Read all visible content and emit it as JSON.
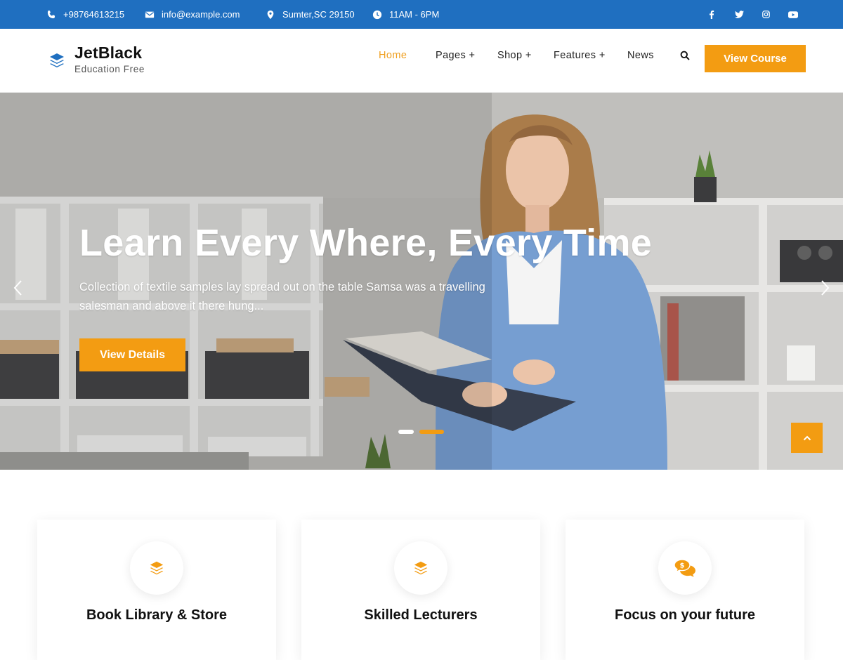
{
  "topbar": {
    "phone": "+98764613215",
    "email": "info@example.com",
    "address": "Sumter,SC 29150",
    "hours": "11AM - 6PM",
    "social": [
      "facebook-icon",
      "twitter-icon",
      "instagram-icon",
      "youtube-icon"
    ],
    "color": "#1f6fc0"
  },
  "header": {
    "logo_title": "JetBlack",
    "logo_subtitle": "Education Free",
    "nav": [
      {
        "label": "Home",
        "active": true
      },
      {
        "label": "Pages +"
      },
      {
        "label": "Shop +"
      },
      {
        "label": "Features +"
      },
      {
        "label": "News"
      }
    ],
    "cta_label": "View Course",
    "accent": "#f39c12"
  },
  "hero": {
    "title": "Learn Every Where, Every Time",
    "text": "Collection of textile samples lay spread out on the table Samsa was a travelling salesman and above it there hung...",
    "button_label": "View Details",
    "slides_total": 2,
    "active_slide": 2
  },
  "features": [
    {
      "title": "Book Library & Store",
      "icon": "layers-icon"
    },
    {
      "title": "Skilled Lecturers",
      "icon": "layers-icon"
    },
    {
      "title": "Focus on your future",
      "icon": "chat-dollar-icon"
    }
  ]
}
